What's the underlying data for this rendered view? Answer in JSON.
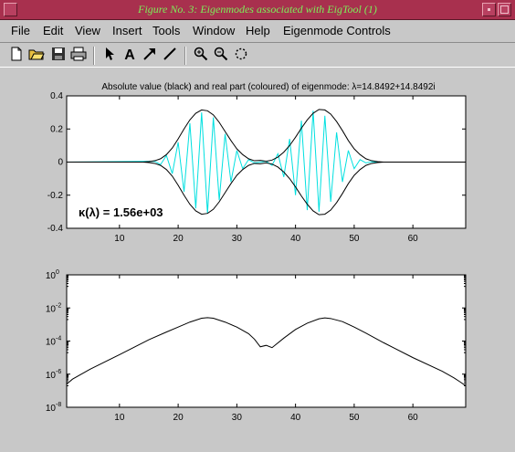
{
  "window": {
    "title": "Figure No. 3: Eigenmodes associated with EigTool (1)"
  },
  "menu": {
    "file": "File",
    "edit": "Edit",
    "view": "View",
    "insert": "Insert",
    "tools": "Tools",
    "window": "Window",
    "help": "Help",
    "eigenmode": "Eigenmode Controls"
  },
  "toolbar": {
    "icons": [
      "new-file-icon",
      "open-folder-icon",
      "save-icon",
      "print-icon",
      "arrow-pointer-icon",
      "text-insert-icon",
      "arrow-insert-icon",
      "line-insert-icon",
      "zoom-in-icon",
      "zoom-out-icon",
      "rotate-icon"
    ]
  },
  "colors": {
    "titlebar": "#a8304e",
    "title_text": "#7cf05a",
    "real_part": "#00e0e0",
    "abs_value": "#000000"
  },
  "chart_data": [
    {
      "type": "line",
      "title": "Absolute value (black) and real part (coloured) of eigenmode: λ=14.8492+14.8492i",
      "annotation": "κ(λ) = 1.56e+03",
      "xlim": [
        1,
        69
      ],
      "ylim": [
        -0.4,
        0.4
      ],
      "xticks": [
        "10",
        "20",
        "30",
        "40",
        "50",
        "60"
      ],
      "yticks": [
        "0.4",
        "0.2",
        "0",
        "-0.2",
        "-0.4"
      ],
      "envelope_x": [
        1,
        14,
        15,
        16,
        17,
        18,
        19,
        20,
        21,
        22,
        23,
        24,
        25,
        26,
        27,
        28,
        29,
        30,
        31,
        32,
        33,
        34,
        35,
        36,
        37,
        38,
        39,
        40,
        41,
        42,
        43,
        44,
        45,
        46,
        47,
        48,
        49,
        50,
        51,
        52,
        53,
        54,
        55,
        69
      ],
      "envelope_y": [
        0,
        0,
        0.003,
        0.008,
        0.02,
        0.045,
        0.085,
        0.14,
        0.2,
        0.255,
        0.295,
        0.315,
        0.31,
        0.285,
        0.24,
        0.185,
        0.13,
        0.08,
        0.045,
        0.02,
        0.008,
        0.01,
        0.005,
        0.012,
        0.03,
        0.06,
        0.1,
        0.15,
        0.205,
        0.255,
        0.295,
        0.318,
        0.315,
        0.29,
        0.245,
        0.19,
        0.13,
        0.08,
        0.045,
        0.02,
        0.008,
        0.003,
        0,
        0
      ],
      "real_x": [
        16,
        17,
        18,
        19,
        20,
        21,
        22,
        23,
        24,
        25,
        26,
        27,
        28,
        29,
        30,
        31,
        32,
        33,
        34,
        35,
        36,
        37,
        38,
        39,
        40,
        41,
        42,
        43,
        44,
        45,
        46,
        47,
        48,
        49,
        50,
        51,
        52,
        53,
        54
      ],
      "real_y": [
        0.005,
        -0.015,
        0.04,
        -0.07,
        0.12,
        -0.18,
        0.235,
        -0.28,
        0.3,
        -0.31,
        0.27,
        -0.23,
        0.17,
        -0.12,
        0.07,
        -0.04,
        0.015,
        -0.005,
        0,
        0.005,
        -0.02,
        0.05,
        -0.09,
        0.14,
        -0.2,
        0.25,
        -0.29,
        0.31,
        -0.3,
        0.28,
        -0.24,
        0.18,
        -0.12,
        0.07,
        -0.04,
        0.015,
        -0.005,
        0.002,
        0
      ]
    },
    {
      "type": "line",
      "scale": "log",
      "xlim": [
        1,
        69
      ],
      "ylim": [
        1e-08,
        1
      ],
      "xticks": [
        "10",
        "20",
        "30",
        "40",
        "50",
        "60"
      ],
      "yticks": [
        "10^0",
        "10^-2",
        "10^-4",
        "10^-6",
        "10^-8"
      ],
      "x": [
        1,
        2,
        5,
        10,
        15,
        18,
        20,
        22,
        24,
        25,
        26,
        28,
        30,
        32,
        33,
        34,
        35,
        36,
        38,
        40,
        42,
        44,
        45,
        46,
        48,
        50,
        52,
        55,
        60,
        65,
        67,
        68,
        69
      ],
      "y": [
        2.5e-07,
        5e-07,
        2e-06,
        1.5e-05,
        0.00012,
        0.00035,
        0.0007,
        0.0014,
        0.0024,
        0.0026,
        0.0024,
        0.0014,
        0.0007,
        0.00028,
        0.00013,
        4.5e-05,
        5.5e-05,
        4e-05,
        0.00015,
        0.0005,
        0.0012,
        0.0022,
        0.0025,
        0.0023,
        0.0015,
        0.0007,
        0.0003,
        8e-05,
        1e-05,
        1.5e-06,
        6e-07,
        3.5e-07,
        2e-07
      ]
    }
  ]
}
